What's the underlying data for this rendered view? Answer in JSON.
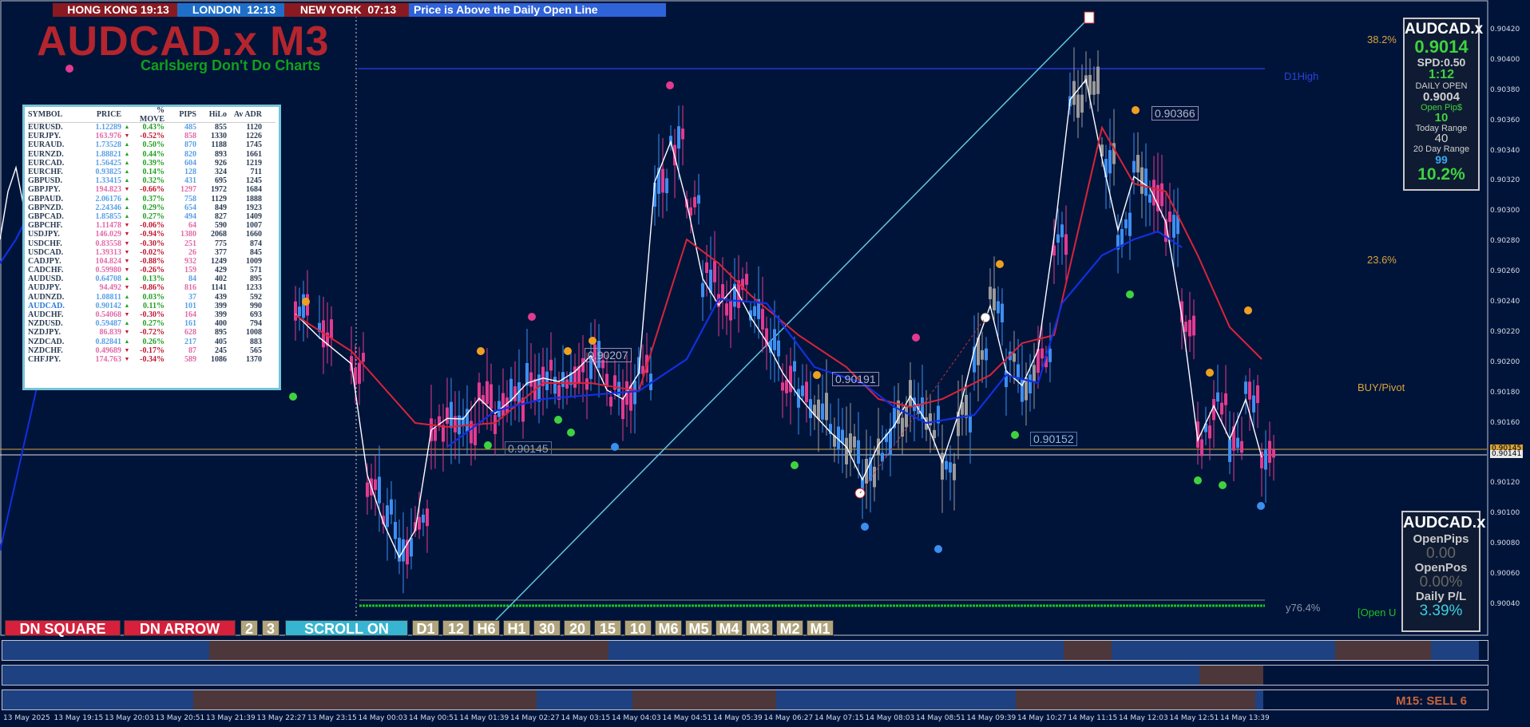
{
  "clocks": [
    {
      "label": "HONG KONG 19:13",
      "color": "#8a1a22"
    },
    {
      "label": "LONDON  12:13",
      "color": "#1f6fc8"
    },
    {
      "label": "NEW YORK  07:13",
      "color": "#8a1a22"
    }
  ],
  "status_banner": "Price is Above the Daily Open Line",
  "symbol_title": "AUDCAD.x M3",
  "subtitle": "Carlsberg Don't Do Charts",
  "watchlist": {
    "headers": [
      "SYMBOL",
      "PRICE",
      "% MOVE",
      "PIPS",
      "HiLo",
      "Av ADR"
    ],
    "rows": [
      {
        "symbol": "EURUSD.",
        "price": "1.12289",
        "dir": "up",
        "move": "0.43%",
        "pips": "485",
        "hilo": "855",
        "adr": "1120"
      },
      {
        "symbol": "EURJPY.",
        "price": "163.976",
        "dir": "down",
        "move": "-0.52%",
        "pips": "858",
        "hilo": "1330",
        "adr": "1226"
      },
      {
        "symbol": "EURAUD.",
        "price": "1.73528",
        "dir": "up",
        "move": "0.50%",
        "pips": "870",
        "hilo": "1188",
        "adr": "1745"
      },
      {
        "symbol": "EURNZD.",
        "price": "1.88821",
        "dir": "up",
        "move": "0.44%",
        "pips": "820",
        "hilo": "893",
        "adr": "1661"
      },
      {
        "symbol": "EURCAD.",
        "price": "1.56425",
        "dir": "up",
        "move": "0.39%",
        "pips": "604",
        "hilo": "926",
        "adr": "1219"
      },
      {
        "symbol": "EURCHF.",
        "price": "0.93825",
        "dir": "up",
        "move": "0.14%",
        "pips": "128",
        "hilo": "324",
        "adr": "711"
      },
      {
        "symbol": "GBPUSD.",
        "price": "1.33415",
        "dir": "up",
        "move": "0.32%",
        "pips": "431",
        "hilo": "695",
        "adr": "1245"
      },
      {
        "symbol": "GBPJPY.",
        "price": "194.823",
        "dir": "down",
        "move": "-0.66%",
        "pips": "1297",
        "hilo": "1972",
        "adr": "1684"
      },
      {
        "symbol": "GBPAUD.",
        "price": "2.06176",
        "dir": "up",
        "move": "0.37%",
        "pips": "758",
        "hilo": "1129",
        "adr": "1888"
      },
      {
        "symbol": "GBPNZD.",
        "price": "2.24346",
        "dir": "up",
        "move": "0.29%",
        "pips": "654",
        "hilo": "849",
        "adr": "1923"
      },
      {
        "symbol": "GBPCAD.",
        "price": "1.85855",
        "dir": "up",
        "move": "0.27%",
        "pips": "494",
        "hilo": "827",
        "adr": "1409"
      },
      {
        "symbol": "GBPCHF.",
        "price": "1.11478",
        "dir": "down",
        "move": "-0.06%",
        "pips": "64",
        "hilo": "590",
        "adr": "1007"
      },
      {
        "symbol": "USDJPY.",
        "price": "146.029",
        "dir": "down",
        "move": "-0.94%",
        "pips": "1380",
        "hilo": "2068",
        "adr": "1660"
      },
      {
        "symbol": "USDCHF.",
        "price": "0.83558",
        "dir": "down",
        "move": "-0.30%",
        "pips": "251",
        "hilo": "775",
        "adr": "874"
      },
      {
        "symbol": "USDCAD.",
        "price": "1.39313",
        "dir": "down",
        "move": "-0.02%",
        "pips": "26",
        "hilo": "377",
        "adr": "845"
      },
      {
        "symbol": "CADJPY.",
        "price": "104.824",
        "dir": "down",
        "move": "-0.88%",
        "pips": "932",
        "hilo": "1249",
        "adr": "1009"
      },
      {
        "symbol": "CADCHF.",
        "price": "0.59980",
        "dir": "down",
        "move": "-0.26%",
        "pips": "159",
        "hilo": "429",
        "adr": "571"
      },
      {
        "symbol": "AUDUSD.",
        "price": "0.64708",
        "dir": "up",
        "move": "0.13%",
        "pips": "84",
        "hilo": "402",
        "adr": "895"
      },
      {
        "symbol": "AUDJPY.",
        "price": "94.492",
        "dir": "down",
        "move": "-0.86%",
        "pips": "816",
        "hilo": "1141",
        "adr": "1233"
      },
      {
        "symbol": "AUDNZD.",
        "price": "1.08811",
        "dir": "up",
        "move": "0.03%",
        "pips": "37",
        "hilo": "439",
        "adr": "592"
      },
      {
        "symbol": "AUDCAD.",
        "price": "0.90142",
        "dir": "up",
        "move": "0.11%",
        "pips": "101",
        "hilo": "399",
        "adr": "990"
      },
      {
        "symbol": "AUDCHF.",
        "price": "0.54068",
        "dir": "down",
        "move": "-0.30%",
        "pips": "164",
        "hilo": "399",
        "adr": "693"
      },
      {
        "symbol": "NZDUSD.",
        "price": "0.59487",
        "dir": "up",
        "move": "0.27%",
        "pips": "161",
        "hilo": "400",
        "adr": "794"
      },
      {
        "symbol": "NZDJPY.",
        "price": "86.839",
        "dir": "down",
        "move": "-0.72%",
        "pips": "628",
        "hilo": "895",
        "adr": "1008"
      },
      {
        "symbol": "NZDCAD.",
        "price": "0.82841",
        "dir": "up",
        "move": "0.26%",
        "pips": "217",
        "hilo": "405",
        "adr": "883"
      },
      {
        "symbol": "NZDCHF.",
        "price": "0.49689",
        "dir": "down",
        "move": "-0.17%",
        "pips": "87",
        "hilo": "245",
        "adr": "565"
      },
      {
        "symbol": "CHFJPY.",
        "price": "174.763",
        "dir": "down",
        "move": "-0.34%",
        "pips": "589",
        "hilo": "1086",
        "adr": "1370"
      }
    ]
  },
  "info_panel": {
    "symbol": "AUDCAD.x",
    "price": "0.9014",
    "spread": "SPD:0.50",
    "candle_timer": "1:12",
    "daily_open_label": "DAILY OPEN",
    "daily_open": "0.9004",
    "open_pips_label": "Open Pip$",
    "open_pips": "10",
    "today_range_label": "Today Range",
    "today_range": "40",
    "range20_label": "20 Day Range",
    "range20": "99",
    "range_pct": "10.2%"
  },
  "pl_panel": {
    "symbol": "AUDCAD.x",
    "open_pips_label": "OpenPips",
    "open_pips": "0.00",
    "open_pos_label": "OpenPos",
    "open_pos": "0.00%",
    "daily_pl_label": "Daily P/L",
    "daily_pl": "3.39%"
  },
  "toolbar": {
    "dn_square": "DN SQUARE",
    "dn_arrow": "DN ARROW",
    "b2": "2",
    "b3": "3",
    "scroll": "SCROLL ON",
    "timeframes": [
      "D1",
      "12",
      "H6",
      "H1",
      "30",
      "20",
      "15",
      "10",
      "M6",
      "M5",
      "M4",
      "M3",
      "M2",
      "M1"
    ]
  },
  "levels": {
    "fib382": "38.2%",
    "fib236": "23.6%",
    "buy_pivot": "BUY/Pivot",
    "fib764": "y76.4%",
    "open_label": "[Open U",
    "d1high": "D1High"
  },
  "price_labels": [
    "0.90366",
    "0.90207",
    "0.90191",
    "0.90152",
    "0.90145"
  ],
  "y_axis": [
    "0.90420",
    "0.90400",
    "0.90380",
    "0.90360",
    "0.90340",
    "0.90320",
    "0.90300",
    "0.90280",
    "0.90260",
    "0.90240",
    "0.90220",
    "0.90200",
    "0.90180",
    "0.90160",
    "0.90140",
    "0.90120",
    "0.90100",
    "0.90080",
    "0.90060",
    "0.90040"
  ],
  "current_prices": {
    "ask": "0.90145",
    "bid": "0.90141"
  },
  "x_axis": [
    "13 May 2025",
    "13 May 19:15",
    "13 May 20:03",
    "13 May 20:51",
    "13 May 21:39",
    "13 May 22:27",
    "13 May 23:15",
    "14 May 00:03",
    "14 May 00:51",
    "14 May 01:39",
    "14 May 02:27",
    "14 May 03:15",
    "14 May 04:03",
    "14 May 04:51",
    "14 May 05:39",
    "14 May 06:27",
    "14 May 07:15",
    "14 May 08:03",
    "14 May 08:51",
    "14 May 09:39",
    "14 May 10:27",
    "14 May 11:15",
    "14 May 12:03",
    "14 May 12:51",
    "14 May 13:39"
  ],
  "signal_text": "M15: SELL 6",
  "colors": {
    "bg": "#00143a",
    "bull": "#3d8ef0",
    "bear": "#e23a8f",
    "ma_red": "#d8243a",
    "ma_blue": "#1030e0",
    "trend": "#5fc8e0"
  }
}
